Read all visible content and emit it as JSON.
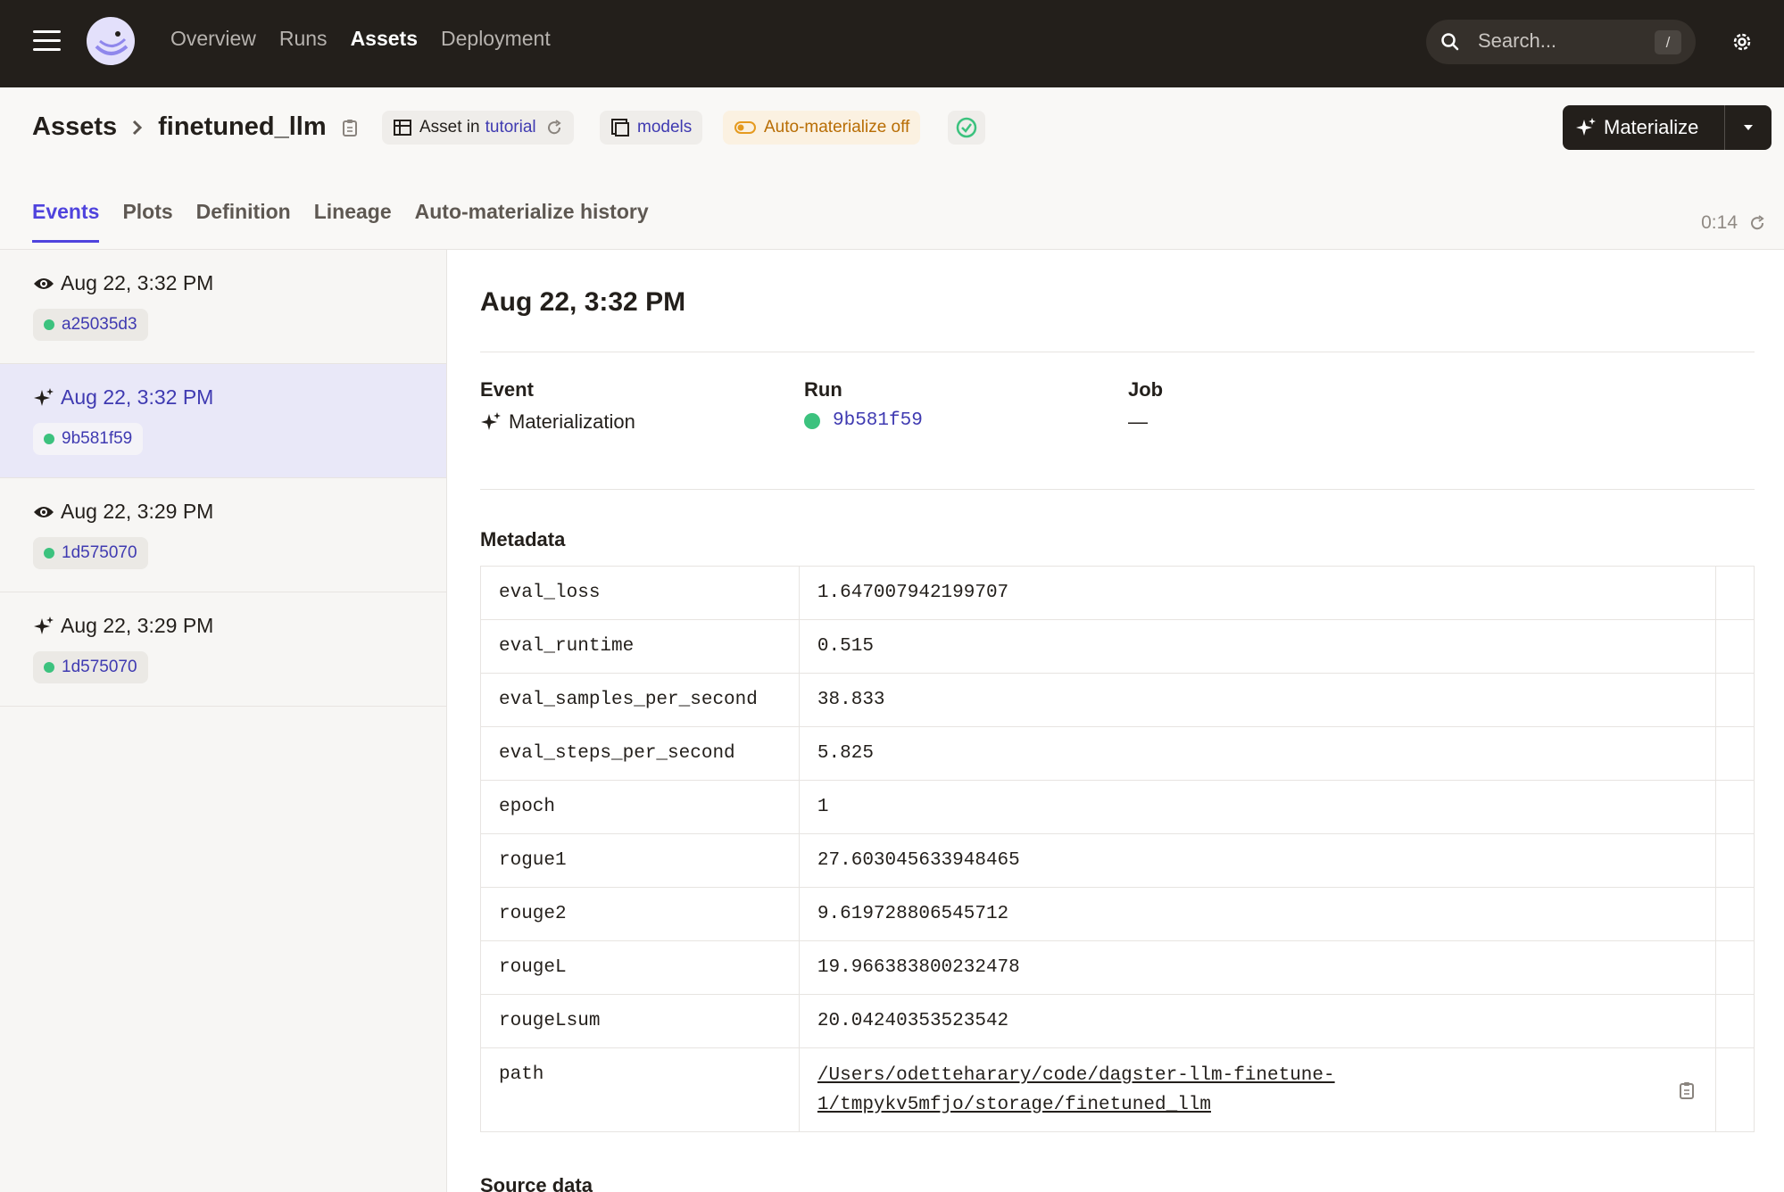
{
  "nav": {
    "links": [
      "Overview",
      "Runs",
      "Assets",
      "Deployment"
    ],
    "active": "Assets",
    "search_placeholder": "Search...",
    "search_shortcut": "/"
  },
  "header": {
    "breadcrumb_root": "Assets",
    "asset_name": "finetuned_llm",
    "asset_in_label": "Asset in",
    "asset_in_location": "tutorial",
    "group_label": "models",
    "automaterialize_label": "Auto-materialize off",
    "materialize_label": "Materialize",
    "tabs": [
      "Events",
      "Plots",
      "Definition",
      "Lineage",
      "Auto-materialize history"
    ],
    "active_tab": "Events",
    "refresh_timer": "0:14"
  },
  "events": [
    {
      "type": "observation",
      "time": "Aug 22, 3:32 PM",
      "run": "a25035d3",
      "selected": false
    },
    {
      "type": "materialization",
      "time": "Aug 22, 3:32 PM",
      "run": "9b581f59",
      "selected": true
    },
    {
      "type": "observation",
      "time": "Aug 22, 3:29 PM",
      "run": "1d575070",
      "selected": false
    },
    {
      "type": "materialization",
      "time": "Aug 22, 3:29 PM",
      "run": "1d575070",
      "selected": false
    }
  ],
  "detail": {
    "title": "Aug 22, 3:32 PM",
    "event_label": "Event",
    "event_value": "Materialization",
    "run_label": "Run",
    "run_value": "9b581f59",
    "job_label": "Job",
    "job_value": "—",
    "metadata_title": "Metadata",
    "metadata": [
      {
        "key": "eval_loss",
        "value": "1.647007942199707"
      },
      {
        "key": "eval_runtime",
        "value": "0.515"
      },
      {
        "key": "eval_samples_per_second",
        "value": "38.833"
      },
      {
        "key": "eval_steps_per_second",
        "value": "5.825"
      },
      {
        "key": "epoch",
        "value": "1"
      },
      {
        "key": "rogue1",
        "value": "27.603045633948465"
      },
      {
        "key": "rouge2",
        "value": "9.619728806545712"
      },
      {
        "key": "rougeL",
        "value": "19.966383800232478"
      },
      {
        "key": "rougeLsum",
        "value": "20.04240353523542"
      }
    ],
    "path_key": "path",
    "path_value": "/Users/odetteharary/code/dagster-llm-finetune-1/tmpykv5mfjo/storage/finetuned_llm",
    "source_title": "Source data"
  },
  "colors": {
    "nav_bg": "#231f1b",
    "accent": "#4f43dd",
    "link": "#3f3ab1",
    "success": "#3cc27e",
    "warning": "#b86d04"
  }
}
